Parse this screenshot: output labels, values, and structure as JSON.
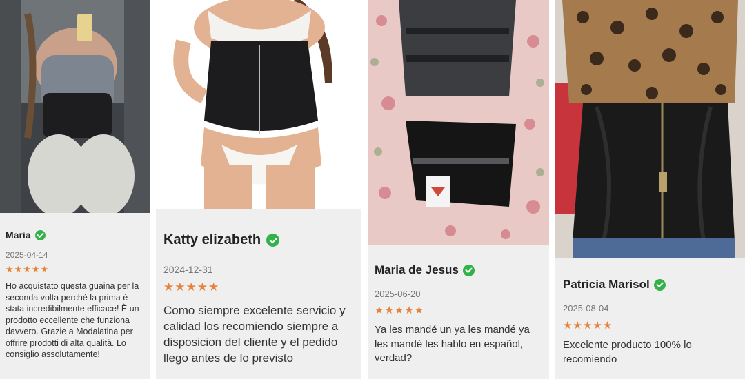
{
  "reviews": [
    {
      "name": "Maria",
      "date": "2025-04-14",
      "stars": "★★★★★",
      "rating": 5,
      "text": "Ho acquistato questa guaina per la seconda volta perché la prima è stata incredibilmente efficace! È un prodotto eccellente che funziona davvero. Grazie a Modalatina per offrire prodotti di alta qualità. Lo consiglio assolutamente!",
      "photo": "gym-mirror-selfie-waist-trainer"
    },
    {
      "name": "Katty elizabeth",
      "date": "2024-12-31",
      "stars": "★★★★★",
      "rating": 5,
      "text": "Como siempre excelente servicio y calidad los recomiendo siempre a disposicion del cliente y el pedido llego antes de lo previsto",
      "photo": "model-black-waist-trainer"
    },
    {
      "name": "Maria de Jesus",
      "date": "2025-06-20",
      "stars": "★★★★★",
      "rating": 5,
      "text": "Ya les mandé un ya les mandé ya les mandé les hablo en español, verdad?",
      "photo": "waist-trainers-on-floral-bed"
    },
    {
      "name": "Patricia Marisol",
      "date": "2025-08-04",
      "stars": "★★★★★",
      "rating": 5,
      "text": "Excelente producto 100% lo recomiendo",
      "photo": "leopard-top-waist-trainer"
    }
  ],
  "colors": {
    "star": "#e8823a",
    "verified": "#33b24a",
    "card_bg": "#efefef"
  },
  "icons": {
    "verified": "check-circle-icon"
  }
}
